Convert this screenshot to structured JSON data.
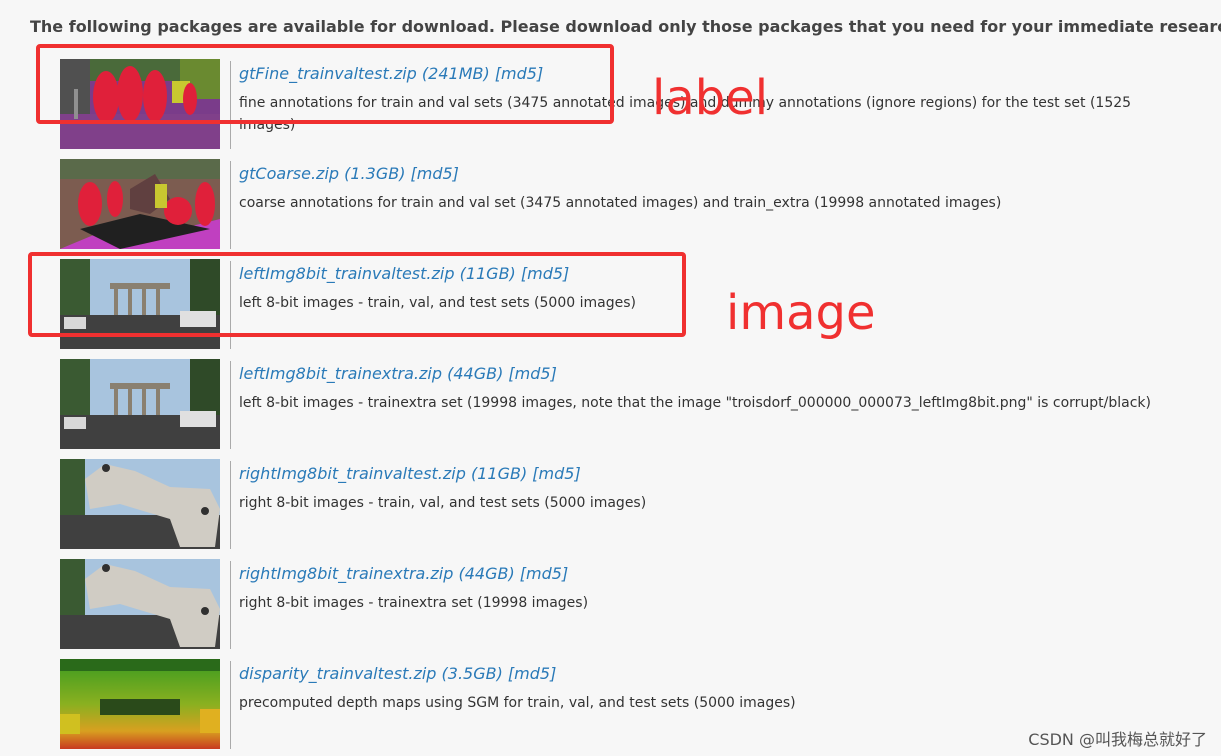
{
  "intro": "The following packages are available for download. Please download only those packages that you need for your immediate research.",
  "packages": [
    {
      "title": "gtFine_trainvaltest.zip (241MB) [md5]",
      "desc": "fine annotations for train and val sets (3475 annotated images) and dummy annotations (ignore regions) for the test set (1525 images)",
      "thumb": "label-fine"
    },
    {
      "title": "gtCoarse.zip (1.3GB) [md5]",
      "desc": "coarse annotations for train and val set (3475 annotated images) and train_extra (19998 annotated images)",
      "thumb": "label-coarse"
    },
    {
      "title": "leftImg8bit_trainvaltest.zip (11GB) [md5]",
      "desc": "left 8-bit images - train, val, and test sets (5000 images)",
      "thumb": "street-photo"
    },
    {
      "title": "leftImg8bit_trainextra.zip (44GB) [md5]",
      "desc": "left 8-bit images - trainextra set (19998 images, note that the image \"troisdorf_000000_000073_leftImg8bit.png\" is corrupt/black)",
      "thumb": "street-photo"
    },
    {
      "title": "rightImg8bit_trainvaltest.zip (11GB) [md5]",
      "desc": "right 8-bit images - train, val, and test sets (5000 images)",
      "thumb": "stereo-rig-photo"
    },
    {
      "title": "rightImg8bit_trainextra.zip (44GB) [md5]",
      "desc": "right 8-bit images - trainextra set (19998 images)",
      "thumb": "stereo-rig-photo"
    },
    {
      "title": "disparity_trainvaltest.zip (3.5GB) [md5]",
      "desc": "precomputed depth maps using SGM for train, val, and test sets (5000 images)",
      "thumb": "depth-map"
    }
  ],
  "annotations": {
    "label": "label",
    "image": "image",
    "color": "#f03030"
  },
  "watermark": "CSDN @叫我梅总就好了"
}
